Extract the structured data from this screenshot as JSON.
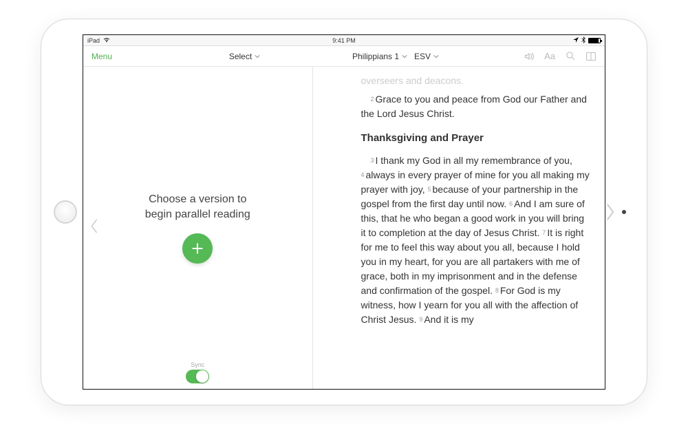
{
  "status": {
    "device": "iPad",
    "time": "9:41 PM"
  },
  "toolbar": {
    "menu": "Menu",
    "select": "Select",
    "book": "Philippians 1",
    "version": "ESV",
    "font_sample": "Aa"
  },
  "left_pane": {
    "placeholder_line1": "Choose a version to",
    "placeholder_line2": "begin parallel reading",
    "sync_label": "Sync"
  },
  "reading": {
    "faded_line": "overseers and deacons.",
    "v2_num": "2",
    "v2_text": "Grace to you and peace from God our Father and the Lord Jesus Christ.",
    "section_head": "Thanksgiving and Prayer",
    "v3_num": "3",
    "v3_text": "I thank my God in all my remembrance of you, ",
    "v4_num": "4",
    "v4_text": "always in every prayer of mine for you all making my prayer with joy, ",
    "v5_num": "5",
    "v5_text": "because of your partnership in the gospel from the first day until now. ",
    "v6_num": "6",
    "v6_text": "And I am sure of this, that he who began a good work in you will bring it to completion at the day of Jesus Christ. ",
    "v7_num": "7",
    "v7_text": "It is right for me to feel this way about you all, because I hold you in my heart, for you are all partakers with me of grace, both in my imprisonment and in the defense and confirmation of the gospel. ",
    "v8_num": "8",
    "v8_text": "For God is my witness, how I yearn for you all with the affection of Christ Jesus. ",
    "v9_num": "9",
    "v9_text": "And it is my"
  }
}
